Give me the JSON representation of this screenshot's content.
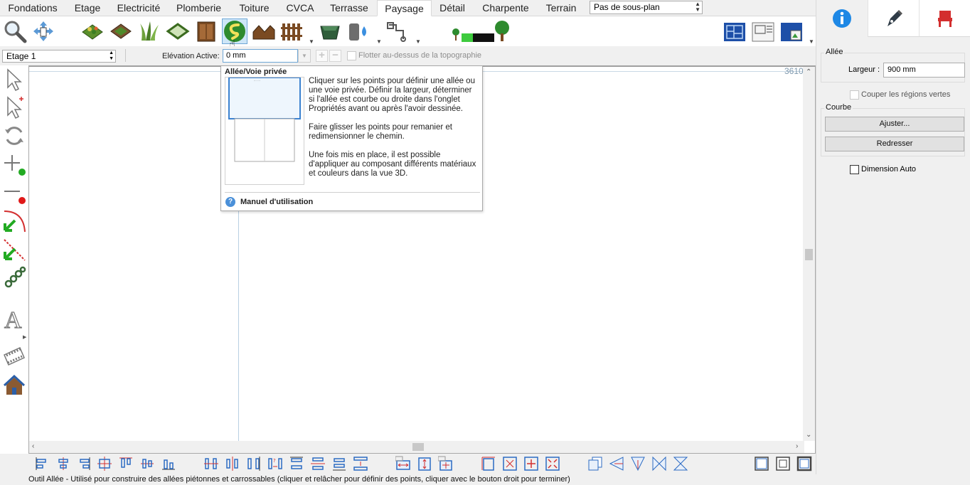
{
  "tabs": [
    {
      "label": "Fondations",
      "active": false
    },
    {
      "label": "Etage",
      "active": false
    },
    {
      "label": "Electricité",
      "active": false
    },
    {
      "label": "Plomberie",
      "active": false
    },
    {
      "label": "Toiture",
      "active": false
    },
    {
      "label": "CVCA",
      "active": false
    },
    {
      "label": "Terrasse",
      "active": false
    },
    {
      "label": "Paysage",
      "active": true
    },
    {
      "label": "Détail",
      "active": false
    },
    {
      "label": "Charpente",
      "active": false
    },
    {
      "label": "Terrain",
      "active": false
    }
  ],
  "subplan_select": "Pas de sous-plan",
  "toolbar_icons": [
    "zoom-icon",
    "pan-icon",
    "plant-bed-icon",
    "garden-plot-icon",
    "grass-icon",
    "path-border-icon",
    "cabinet-icon",
    "driveway-icon",
    "shed-icon",
    "fence-icon",
    "pool-icon",
    "water-tap-icon",
    "irrigation-icon",
    "plant-growth-icon",
    "tree-icon",
    "plan-view-1-icon",
    "plan-view-2-icon",
    "plan-view-3-icon"
  ],
  "levelrow": {
    "level": "Etage 1",
    "elevation_label": "Elévation Active:",
    "elevation_value": "0 mm",
    "float_label": "Flotter au-dessus de la topographie"
  },
  "canvas": {
    "coord_text": "3610"
  },
  "tooltip": {
    "title": "Allée/Voie privée",
    "paragraph1": "Cliquer sur les points pour définir une allée ou une voie privée. Définir la largeur, déterminer si l'allée est courbe ou droite dans l'onglet Propriétés avant ou après l'avoir dessinée.",
    "paragraph2": "Faire glisser les points pour remanier et redimensionner le chemin.",
    "paragraph3": "Une fois mis en place, il est possible d'appliquer au composant différents matériaux et couleurs dans la vue 3D.",
    "manual_link": "Manuel d'utilisation"
  },
  "right_panel": {
    "tabs": [
      "info-icon",
      "pen-icon",
      "chair-icon"
    ],
    "allee_group": "Allée",
    "width_label": "Largeur :",
    "width_value": "900 mm",
    "cut_green_label": "Couper les régions vertes",
    "curve_group": "Courbe",
    "adjust_button": "Ajuster...",
    "straighten_button": "Redresser",
    "auto_dim_label": "Dimension Auto"
  },
  "status_text": "Outil Allée - Utilisé pour construire des allées piétonnes et carrossables (cliquer et relâcher pour définir des points, cliquer avec le bouton droit pour terminer)",
  "colors": {
    "accent": "#1e88e5",
    "green": "#3aa83a",
    "red": "#d32f2f",
    "brown": "#7a5230",
    "selection": "#cde6f7"
  }
}
